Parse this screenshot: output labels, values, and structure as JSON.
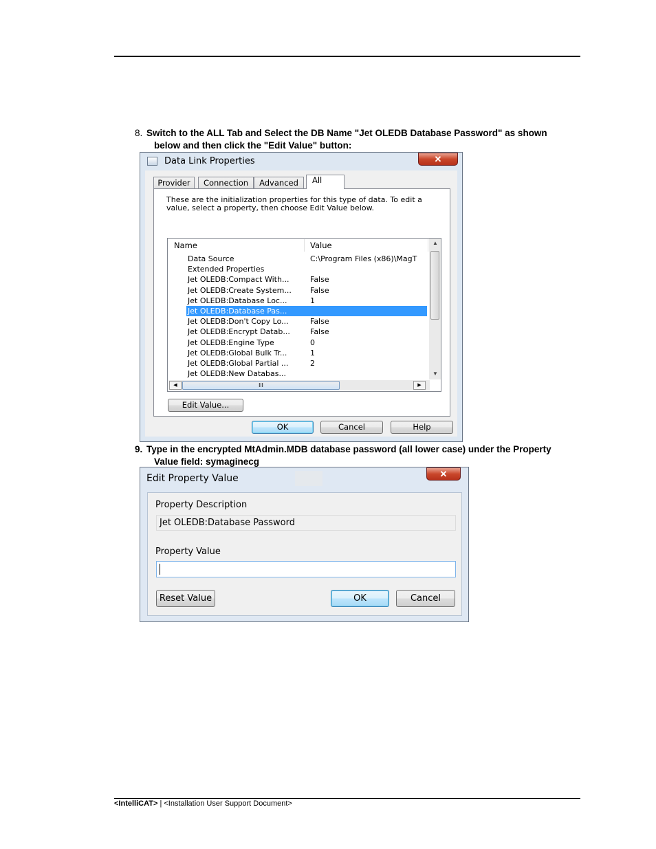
{
  "steps": [
    {
      "number": "8.",
      "line1": "Switch to the ALL Tab and Select the DB Name \"Jet OLEDB Database Password\" as shown",
      "line2": "below and then click the \"Edit Value\" button:"
    },
    {
      "number": "9.",
      "line1": "Type in the encrypted MtAdmin.MDB database password (all lower case) under the Property",
      "line2": "Value field: symaginecg"
    }
  ],
  "data_link_dialog": {
    "title": "Data Link Properties",
    "close_glyph": "✕",
    "tabs": [
      "Provider",
      "Connection",
      "Advanced",
      "All"
    ],
    "active_tab": "All",
    "description": "These are the initialization properties for this type of data. To edit a value, select a property, then choose Edit Value below.",
    "columns": [
      "Name",
      "Value"
    ],
    "rows": [
      {
        "name": "Data Source",
        "value": "C:\\Program Files (x86)\\MagT"
      },
      {
        "name": "Extended Properties",
        "value": ""
      },
      {
        "name": "Jet OLEDB:Compact With...",
        "value": "False"
      },
      {
        "name": "Jet OLEDB:Create System...",
        "value": "False"
      },
      {
        "name": "Jet OLEDB:Database Loc...",
        "value": "1"
      },
      {
        "name": "Jet OLEDB:Database Pas...",
        "value": ""
      },
      {
        "name": "Jet OLEDB:Don't Copy Lo...",
        "value": "False"
      },
      {
        "name": "Jet OLEDB:Encrypt Datab...",
        "value": "False"
      },
      {
        "name": "Jet OLEDB:Engine Type",
        "value": "0"
      },
      {
        "name": "Jet OLEDB:Global Bulk Tr...",
        "value": "1"
      },
      {
        "name": "Jet OLEDB:Global Partial ...",
        "value": "2"
      },
      {
        "name": "Jet OLEDB:New Databas...",
        "value": ""
      }
    ],
    "selected_row": "Jet OLEDB:Database Pas...",
    "edit_value_button": "Edit Value...",
    "ok_button": "OK",
    "cancel_button": "Cancel",
    "help_button": "Help",
    "hscroll_thumb_glyph": "III"
  },
  "edit_property_dialog": {
    "title": "Edit Property Value",
    "close_glyph": "✕",
    "description_label": "Property Description",
    "description_value": "Jet OLEDB:Database Password",
    "value_label": "Property Value",
    "value_input": "",
    "reset_button": "Reset Value",
    "ok_button": "OK",
    "cancel_button": "Cancel"
  },
  "footer": {
    "product": "<IntelliCAT>",
    "separator": "|",
    "document": "<Installation User Support Document>"
  },
  "colors": {
    "selection": "#3399ff",
    "close_button": "#c9472b"
  }
}
